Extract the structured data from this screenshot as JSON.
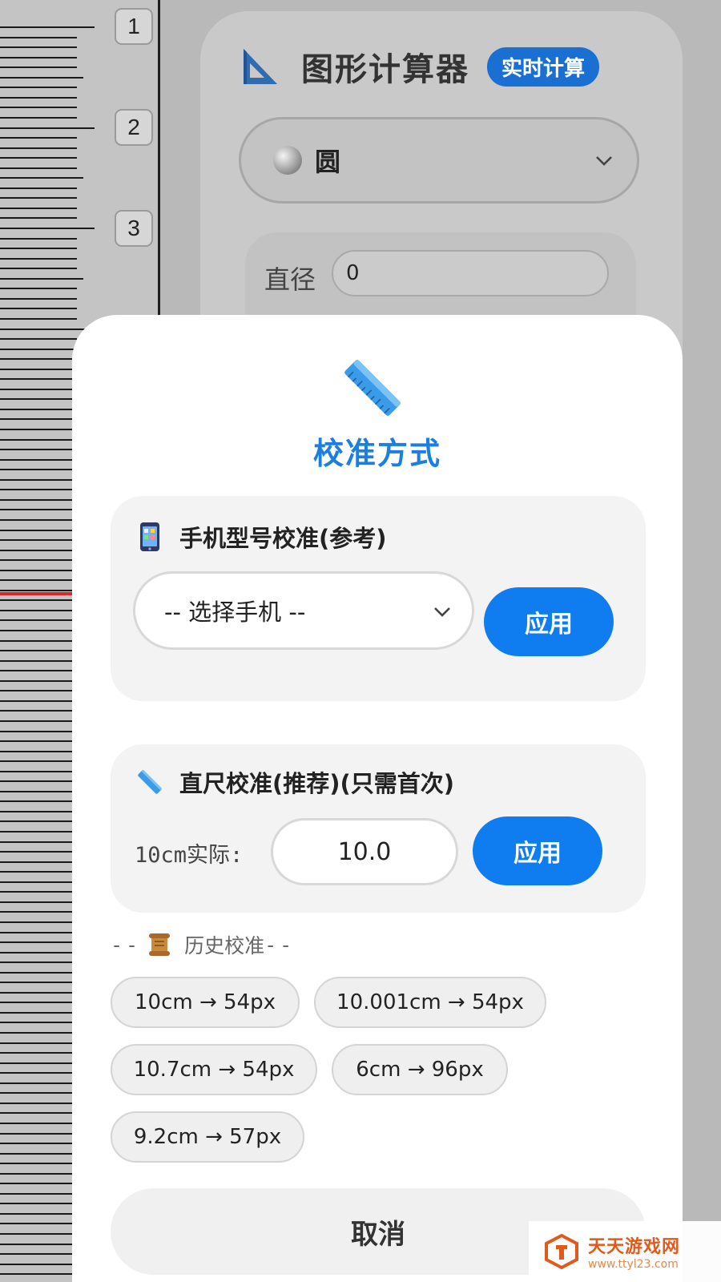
{
  "ruler": {
    "numbers": [
      "1",
      "2",
      "3"
    ]
  },
  "calculator": {
    "title": "图形计算器",
    "badge": "实时计算",
    "shape_selected": "圆",
    "dimension_label": "直径",
    "dimension_value": "0"
  },
  "modal": {
    "title": "校准方式",
    "phone_section": {
      "heading": "手机型号校准(参考)",
      "select_value": "-- 选择手机 --",
      "apply_label": "应用"
    },
    "ruler_section": {
      "heading": "直尺校准(推荐)(只需首次)",
      "input_label": "10cm实际:",
      "input_value": "10.0",
      "apply_label": "应用"
    },
    "history": {
      "prefix": "--",
      "heading": "历史校准",
      "suffix": "--",
      "items": [
        "10cm → 54px",
        "10.001cm → 54px",
        "10.7cm → 54px",
        "6cm → 96px",
        "9.2cm → 57px"
      ]
    },
    "cancel_label": "取消"
  },
  "watermark": {
    "name": "天天游戏网",
    "url": "www.ttyl23.com"
  },
  "colors": {
    "accent": "#0f7cf0",
    "title_blue": "#1a7fe0",
    "badge_blue": "#1a6fd3",
    "ruler_red": "#d8282a"
  }
}
